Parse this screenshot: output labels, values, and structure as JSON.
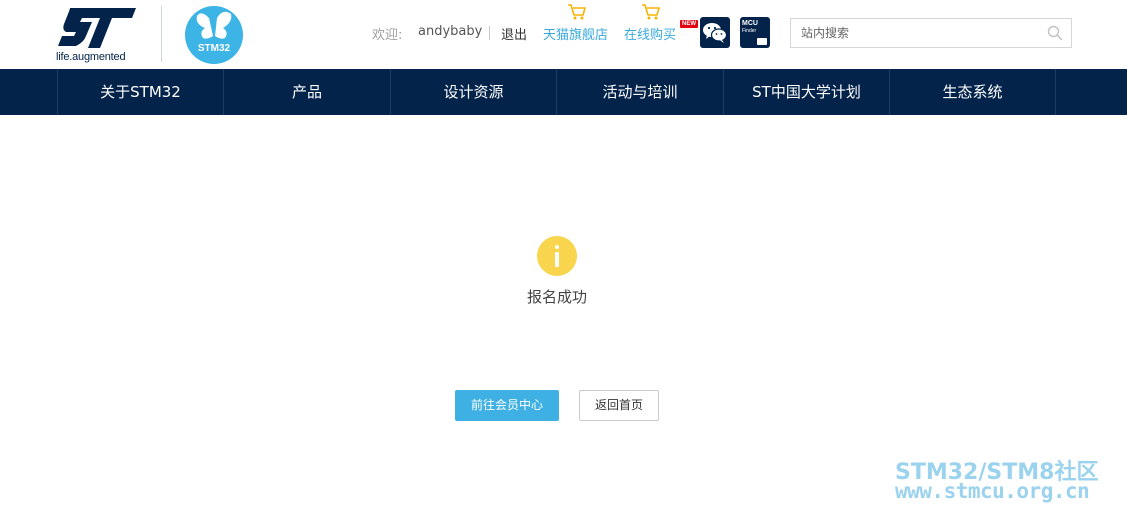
{
  "header": {
    "brand_tagline": "life.augmented",
    "stm32_badge": "STM32",
    "welcome_label": "欢迎:",
    "username": "andybaby",
    "logout_label": "退出",
    "tmall_store_label": "天猫旗舰店",
    "online_shop_label": "在线购买",
    "new_badge": "NEW",
    "mcu_finder_title": "MCU",
    "mcu_finder_subtitle": "Finder",
    "search_placeholder": "站内搜索"
  },
  "nav": {
    "items": [
      {
        "label": "关于STM32"
      },
      {
        "label": "产品"
      },
      {
        "label": "设计资源"
      },
      {
        "label": "活动与培训"
      },
      {
        "label": "ST中国大学计划"
      },
      {
        "label": "生态系统"
      }
    ]
  },
  "main": {
    "status_icon": "info-icon",
    "message": "报名成功",
    "primary_button": "前往会员中心",
    "secondary_button": "返回首页"
  },
  "watermark": {
    "line1": "STM32/STM8社区",
    "line2": "www.stmcu.org.cn"
  },
  "colors": {
    "nav_bg": "#03234b",
    "accent": "#3cb4e6",
    "primary_button": "#3fb0e3",
    "info_icon": "#f9d54d",
    "new_badge": "#e60012"
  }
}
